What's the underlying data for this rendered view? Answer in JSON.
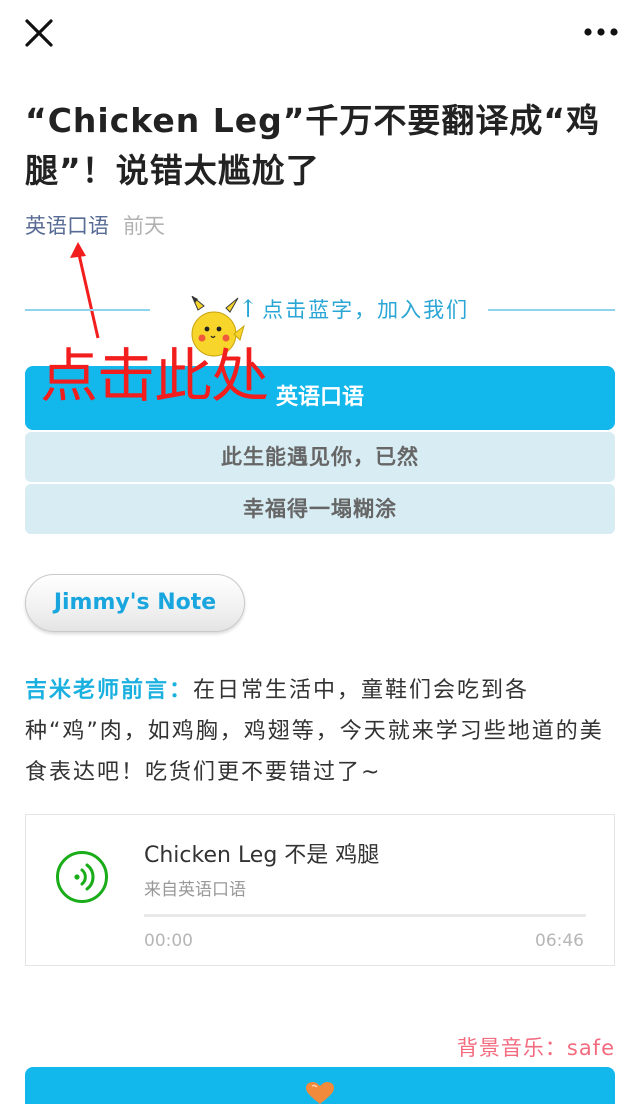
{
  "topbar": {
    "close_icon": "close-icon",
    "more_icon": "more-dots-icon"
  },
  "article": {
    "title": "“Chicken Leg”千万不要翻译成“鸡腿”！说错太尴尬了",
    "account": "英语口语",
    "date": "前天"
  },
  "follow": {
    "hint": "点击蓝字，加入我们",
    "arrow": "↑",
    "mascot_icon": "pikachu-icon",
    "annotation": "点击此处",
    "annotation_color": "#f21d1d"
  },
  "banner": {
    "main": "英语口语",
    "line1": "此生能遇见你，已然",
    "line2": "幸福得一塌糊涂",
    "accent": "#12b7eb"
  },
  "note_button": {
    "label": "Jimmy's Note"
  },
  "intro": {
    "lead": "吉米老师前言：",
    "body": "在日常生活中，童鞋们会吃到各种“鸡”肉，如鸡胸，鸡翅等，今天就来学习些地道的美食表达吧！吃货们更不要错过了~"
  },
  "audio": {
    "title": "Chicken Leg 不是 鸡腿",
    "source": "来自英语口语",
    "current_time": "00:00",
    "duration": "06:46",
    "progress": 0,
    "play_icon": "audio-play-icon"
  },
  "footer": {
    "bgm": "背景音乐：safe",
    "heart_icon": "heart-icon"
  }
}
